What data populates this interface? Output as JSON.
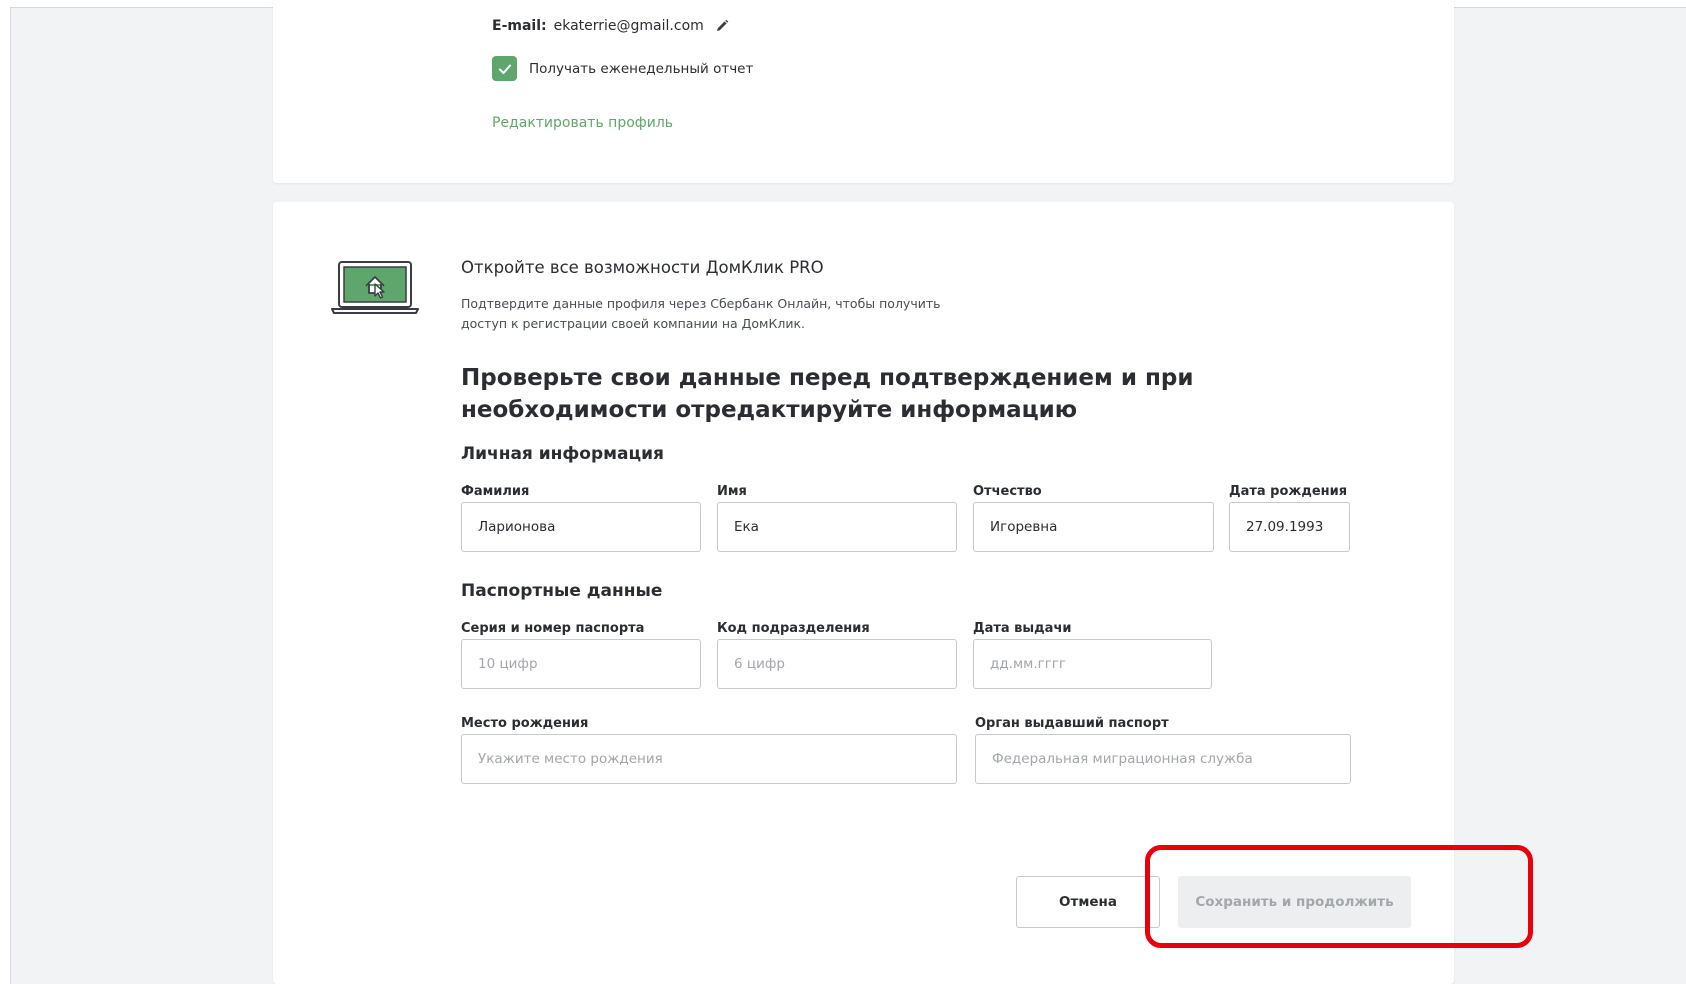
{
  "profile": {
    "email_label": "E-mail:",
    "email_value": "ekaterrie@gmail.com",
    "weekly_report_label": "Получать еженедельный отчет",
    "weekly_report_checked": true,
    "edit_profile_link": "Редактировать профиль"
  },
  "promo": {
    "title": "Откройте все возможности ДомКлик PRO",
    "text": "Подтвердите данные профиля через Сбербанк Онлайн, чтобы получить доступ к регистрации своей компании на ДомКлик."
  },
  "form": {
    "heading": "Проверьте свои данные перед подтверждением и при необходимости отредактируйте информацию",
    "personal": {
      "title": "Личная информация",
      "last_name_label": "Фамилия",
      "last_name_value": "Ларионова",
      "first_name_label": "Имя",
      "first_name_value": "Ека",
      "patronymic_label": "Отчество",
      "patronymic_value": "Игоревна",
      "birth_date_label": "Дата рождения",
      "birth_date_value": "27.09.1993"
    },
    "passport": {
      "title": "Паспортные данные",
      "number_label": "Серия и номер паспорта",
      "number_placeholder": "10 цифр",
      "dept_code_label": "Код подразделения",
      "dept_code_placeholder": "6 цифр",
      "issue_date_label": "Дата выдачи",
      "issue_date_placeholder": "дд.мм.гггг",
      "birth_place_label": "Место рождения",
      "birth_place_placeholder": "Укажите место рождения",
      "issuer_label": "Орган выдавший паспорт",
      "issuer_placeholder": "Федеральная миграционная служба"
    },
    "buttons": {
      "cancel": "Отмена",
      "save": "Сохранить и продолжить"
    }
  },
  "colors": {
    "accent": "#5fa66c",
    "highlight": "#e8000b"
  }
}
